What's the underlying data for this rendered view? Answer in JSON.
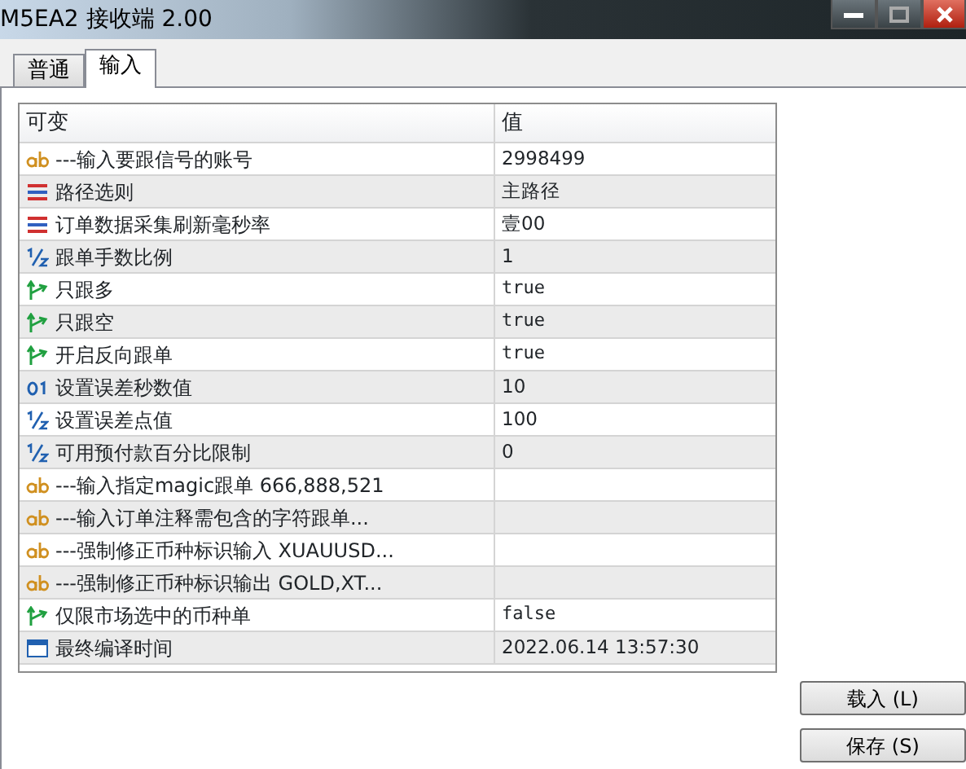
{
  "window": {
    "title": "M5EA2 接收端 2.00"
  },
  "tabs": [
    {
      "label": "普通",
      "selected": false
    },
    {
      "label": "输入",
      "selected": true
    }
  ],
  "table": {
    "columns": [
      "可变",
      "值"
    ],
    "rows": [
      {
        "kind": "string",
        "name": "---输入要跟信号的账号",
        "value": "2998499"
      },
      {
        "kind": "enum",
        "name": "路径选则",
        "value": "主路径"
      },
      {
        "kind": "enum",
        "name": "订单数据采集刷新毫秒率",
        "value": "壹00"
      },
      {
        "kind": "double",
        "name": "跟单手数比例",
        "value": "1"
      },
      {
        "kind": "bool",
        "name": "只跟多",
        "value": "true"
      },
      {
        "kind": "bool",
        "name": "只跟空",
        "value": "true"
      },
      {
        "kind": "bool",
        "name": "开启反向跟单",
        "value": "true"
      },
      {
        "kind": "int",
        "name": "设置误差秒数值",
        "value": "10"
      },
      {
        "kind": "double",
        "name": "设置误差点值",
        "value": "100"
      },
      {
        "kind": "double",
        "name": "可用预付款百分比限制",
        "value": "0"
      },
      {
        "kind": "string",
        "name": "---输入指定magic跟单 666,888,521"
      },
      {
        "kind": "string",
        "name": "---输入订单注释需包含的字符跟单..."
      },
      {
        "kind": "string",
        "name": "---强制修正币种标识输入 XUAUUSD..."
      },
      {
        "kind": "string",
        "name": "---强制修正币种标识输出 GOLD,XT..."
      },
      {
        "kind": "bool",
        "name": "仅限市场选中的币种单",
        "value": "false"
      },
      {
        "kind": "datetime",
        "name": "最终编译时间",
        "value": "2022.06.14 13:57:30"
      }
    ]
  },
  "buttons": [
    "载入 (L)",
    "保存 (S)"
  ]
}
